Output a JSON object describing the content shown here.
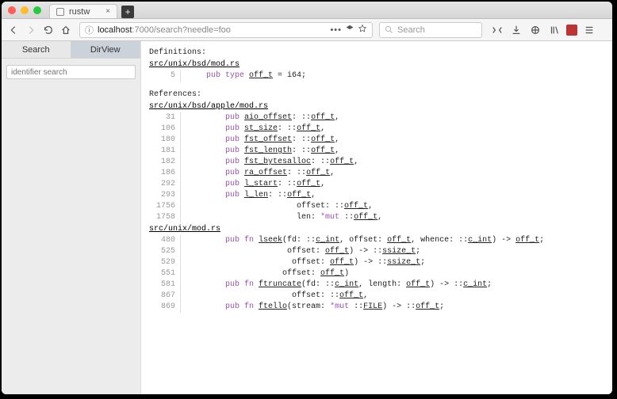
{
  "window": {
    "tab_title": "rustw"
  },
  "toolbar": {
    "url_info_icon": "ⓘ",
    "url_host": "localhost",
    "url_port": ":7000",
    "url_path": "/search?needle=foo",
    "search_placeholder": "Search"
  },
  "sidebar": {
    "tabs": {
      "search": "Search",
      "dirview": "DirView"
    },
    "search_placeholder": "identifier search"
  },
  "results": {
    "definitions_label": "Definitions:",
    "references_label": "References:",
    "definitions": [
      {
        "file": "src/unix/bsd/mod.rs",
        "lines": [
          {
            "n": 5,
            "segs": [
              [
                "kw",
                "pub type "
              ],
              [
                "ul",
                "off_t"
              ],
              [
                "",
                " = i64;"
              ]
            ]
          }
        ]
      }
    ],
    "references": [
      {
        "file": "src/unix/bsd/apple/mod.rs",
        "lines": [
          {
            "n": 31,
            "segs": [
              [
                "kw",
                "pub "
              ],
              [
                "ul",
                "aio_offset"
              ],
              [
                "",
                ": ::"
              ],
              [
                "ul",
                "off_t"
              ],
              [
                "",
                ","
              ]
            ]
          },
          {
            "n": 106,
            "segs": [
              [
                "kw",
                "pub "
              ],
              [
                "ul",
                "st_size"
              ],
              [
                "",
                ": ::"
              ],
              [
                "ul",
                "off_t"
              ],
              [
                "",
                ","
              ]
            ]
          },
          {
            "n": 180,
            "segs": [
              [
                "kw",
                "pub "
              ],
              [
                "ul",
                "fst_offset"
              ],
              [
                "",
                ": ::"
              ],
              [
                "ul",
                "off_t"
              ],
              [
                "",
                ","
              ]
            ]
          },
          {
            "n": 181,
            "segs": [
              [
                "kw",
                "pub "
              ],
              [
                "ul",
                "fst_length"
              ],
              [
                "",
                ": ::"
              ],
              [
                "ul",
                "off_t"
              ],
              [
                "",
                ","
              ]
            ]
          },
          {
            "n": 182,
            "segs": [
              [
                "kw",
                "pub "
              ],
              [
                "ul",
                "fst_bytesalloc"
              ],
              [
                "",
                ": ::"
              ],
              [
                "ul",
                "off_t"
              ],
              [
                "",
                ","
              ]
            ]
          },
          {
            "n": 186,
            "segs": [
              [
                "kw",
                "pub "
              ],
              [
                "ul",
                "ra_offset"
              ],
              [
                "",
                ": ::"
              ],
              [
                "ul",
                "off_t"
              ],
              [
                "",
                ","
              ]
            ]
          },
          {
            "n": 292,
            "segs": [
              [
                "kw",
                "pub "
              ],
              [
                "ul",
                "l_start"
              ],
              [
                "",
                ": ::"
              ],
              [
                "ul",
                "off_t"
              ],
              [
                "",
                ","
              ]
            ]
          },
          {
            "n": 293,
            "segs": [
              [
                "kw",
                "pub "
              ],
              [
                "ul",
                "l_len"
              ],
              [
                "",
                ": ::"
              ],
              [
                "ul",
                "off_t"
              ],
              [
                "",
                ","
              ]
            ]
          },
          {
            "n": 1756,
            "segs": [
              [
                "",
                "               offset: ::"
              ],
              [
                "ul",
                "off_t"
              ],
              [
                "",
                ","
              ]
            ]
          },
          {
            "n": 1758,
            "segs": [
              [
                "",
                "               len: "
              ],
              [
                "kw",
                "*mut "
              ],
              [
                "",
                "::"
              ],
              [
                "ul",
                "off_t"
              ],
              [
                "",
                ","
              ]
            ]
          }
        ]
      },
      {
        "file": "src/unix/mod.rs",
        "lines": [
          {
            "n": 480,
            "segs": [
              [
                "kw",
                "pub fn "
              ],
              [
                "ul",
                "lseek"
              ],
              [
                "",
                "(fd: ::"
              ],
              [
                "ul",
                "c_int"
              ],
              [
                "",
                ", offset: "
              ],
              [
                "ul",
                "off_t"
              ],
              [
                "",
                ", whence: ::"
              ],
              [
                "ul",
                "c_int"
              ],
              [
                "",
                ") -> "
              ],
              [
                "ul",
                "off_t"
              ],
              [
                "",
                ";"
              ]
            ]
          },
          {
            "n": 525,
            "segs": [
              [
                "",
                "             offset: "
              ],
              [
                "ul",
                "off_t"
              ],
              [
                "",
                ") -> ::"
              ],
              [
                "ul",
                "ssize_t"
              ],
              [
                "",
                ";"
              ]
            ]
          },
          {
            "n": 529,
            "segs": [
              [
                "",
                "              offset: "
              ],
              [
                "ul",
                "off_t"
              ],
              [
                "",
                ") -> ::"
              ],
              [
                "ul",
                "ssize_t"
              ],
              [
                "",
                ";"
              ]
            ]
          },
          {
            "n": 551,
            "segs": [
              [
                "",
                "            offset: "
              ],
              [
                "ul",
                "off_t"
              ],
              [
                "",
                ")"
              ]
            ]
          },
          {
            "n": 581,
            "segs": [
              [
                "kw",
                "pub fn "
              ],
              [
                "ul",
                "ftruncate"
              ],
              [
                "",
                "(fd: ::"
              ],
              [
                "ul",
                "c_int"
              ],
              [
                "",
                ", length: "
              ],
              [
                "ul",
                "off_t"
              ],
              [
                "",
                ") -> ::"
              ],
              [
                "ul",
                "c_int"
              ],
              [
                "",
                ";"
              ]
            ]
          },
          {
            "n": 867,
            "segs": [
              [
                "",
                "              offset: ::"
              ],
              [
                "ul",
                "off_t"
              ],
              [
                "",
                ","
              ]
            ]
          },
          {
            "n": 869,
            "segs": [
              [
                "kw",
                "pub fn "
              ],
              [
                "ul",
                "ftello"
              ],
              [
                "",
                "(stream: "
              ],
              [
                "kw",
                "*mut "
              ],
              [
                "",
                "::"
              ],
              [
                "ul",
                "FILE"
              ],
              [
                "",
                ") -> ::"
              ],
              [
                "ul",
                "off_t"
              ],
              [
                "",
                ";"
              ]
            ]
          }
        ]
      }
    ]
  }
}
